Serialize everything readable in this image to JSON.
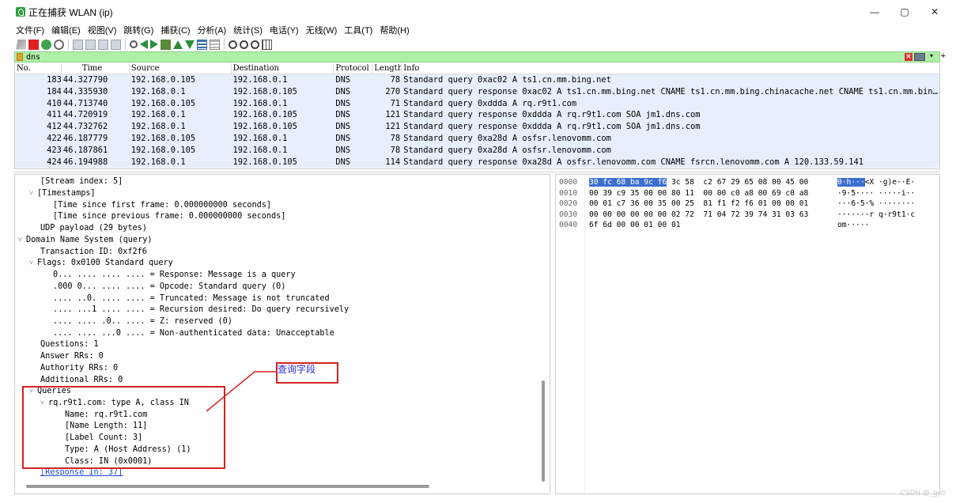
{
  "window": {
    "title": "正在捕获 WLAN (ip)",
    "controls": {
      "minimize": "—",
      "maximize": "▢",
      "close": "✕"
    }
  },
  "menu": [
    "文件(F)",
    "编辑(E)",
    "视图(V)",
    "跳转(G)",
    "捕获(C)",
    "分析(A)",
    "统计(S)",
    "电话(Y)",
    "无线(W)",
    "工具(T)",
    "帮助(H)"
  ],
  "toolbar": {
    "icons": [
      "shark-fin-icon",
      "stop-icon",
      "restart-icon",
      "capture-options-icon",
      "open-file-icon",
      "save-file-icon",
      "close-file-icon",
      "reload-icon",
      "find-icon",
      "go-back-icon",
      "go-forward-icon",
      "go-to-packet-icon",
      "first-packet-icon",
      "last-packet-icon",
      "autoscroll-icon",
      "colorize-icon",
      "zoom-in-icon",
      "zoom-out-icon",
      "zoom-normal-icon",
      "resize-columns-icon"
    ]
  },
  "filter": {
    "value": "dns"
  },
  "packet_list": {
    "columns": [
      "No.",
      "Time",
      "Source",
      "Destination",
      "Protocol",
      "Length",
      "Info"
    ],
    "rows": [
      {
        "no": "183",
        "time": "44.327790",
        "src": "192.168.0.105",
        "dst": "192.168.0.1",
        "proto": "DNS",
        "len": "78",
        "info": "Standard query 0xac02 A ts1.cn.mm.bing.net"
      },
      {
        "no": "184",
        "time": "44.335930",
        "src": "192.168.0.1",
        "dst": "192.168.0.105",
        "proto": "DNS",
        "len": "270",
        "info": "Standard query response 0xac02 A ts1.cn.mm.bing.net CNAME ts1.cn.mm.bing.chinacache.net CNAME ts1.cn.mm.bing…"
      },
      {
        "no": "410",
        "time": "44.713740",
        "src": "192.168.0.105",
        "dst": "192.168.0.1",
        "proto": "DNS",
        "len": "71",
        "info": "Standard query 0xddda A rq.r9t1.com"
      },
      {
        "no": "411",
        "time": "44.720919",
        "src": "192.168.0.1",
        "dst": "192.168.0.105",
        "proto": "DNS",
        "len": "121",
        "info": "Standard query response 0xddda A rq.r9t1.com SOA jm1.dns.com"
      },
      {
        "no": "412",
        "time": "44.732762",
        "src": "192.168.0.1",
        "dst": "192.168.0.105",
        "proto": "DNS",
        "len": "121",
        "info": "Standard query response 0xddda A rq.r9t1.com SOA jm1.dns.com"
      },
      {
        "no": "422",
        "time": "46.187779",
        "src": "192.168.0.105",
        "dst": "192.168.0.1",
        "proto": "DNS",
        "len": "78",
        "info": "Standard query 0xa28d A osfsr.lenovomm.com"
      },
      {
        "no": "423",
        "time": "46.187861",
        "src": "192.168.0.105",
        "dst": "192.168.0.1",
        "proto": "DNS",
        "len": "78",
        "info": "Standard query 0xa28d A osfsr.lenovomm.com"
      },
      {
        "no": "424",
        "time": "46.194988",
        "src": "192.168.0.1",
        "dst": "192.168.0.105",
        "proto": "DNS",
        "len": "114",
        "info": "Standard query response 0xa28d A osfsr.lenovomm.com CNAME fsrcn.lenovomm.com A 120.133.59.141"
      }
    ]
  },
  "details": {
    "stream_index": "[Stream index: 5]",
    "timestamps": "[Timestamps]",
    "time_first": "[Time since first frame: 0.000000000 seconds]",
    "time_prev": "[Time since previous frame: 0.000000000 seconds]",
    "udp_payload": "UDP payload (29 bytes)",
    "dns": "Domain Name System (query)",
    "transaction_id": "Transaction ID: 0xf2f6",
    "flags": "Flags: 0x0100 Standard query",
    "flag_response": "0... .... .... .... = Response: Message is a query",
    "flag_opcode": ".000 0... .... .... = Opcode: Standard query (0)",
    "flag_truncated": ".... ..0. .... .... = Truncated: Message is not truncated",
    "flag_recursion": ".... ...1 .... .... = Recursion desired: Do query recursively",
    "flag_z": ".... .... .0.. .... = Z: reserved (0)",
    "flag_nonauth": ".... .... ...0 .... = Non-authenticated data: Unacceptable",
    "questions": "Questions: 1",
    "answer_rrs": "Answer RRs: 0",
    "authority_rrs": "Authority RRs: 0",
    "additional_rrs": "Additional RRs: 0",
    "queries": "Queries",
    "query": "rq.r9t1.com: type A, class IN",
    "name": "Name: rq.r9t1.com",
    "name_length": "[Name Length: 11]",
    "label_count": "[Label Count: 3]",
    "type": "Type: A (Host Address) (1)",
    "class": "Class: IN (0x0001)",
    "response_in": "[Response In: 37]"
  },
  "bytes": [
    {
      "offset": "0000",
      "hex_hl": "30 fc 68 ba 9c f6",
      "hex_rest": " 3c 58  c2 67 29 65 08 00 45 00",
      "ascii_hl": "0·h···",
      "ascii_rest": "<X ·g)e··E·"
    },
    {
      "offset": "0010",
      "hex_hl": "",
      "hex_rest": "00 39 c9 35 00 00 80 11  00 00 c0 a8 00 69 c0 a8",
      "ascii_hl": "",
      "ascii_rest": "·9·5···· ·····i··"
    },
    {
      "offset": "0020",
      "hex_hl": "",
      "hex_rest": "00 01 c7 36 00 35 00 25  81 f1 f2 f6 01 00 00 01",
      "ascii_hl": "",
      "ascii_rest": "···6·5·% ········"
    },
    {
      "offset": "0030",
      "hex_hl": "",
      "hex_rest": "00 00 00 00 00 00 02 72  71 04 72 39 74 31 03 63",
      "ascii_hl": "",
      "ascii_rest": "·······r q·r9t1·c"
    },
    {
      "offset": "0040",
      "hex_hl": "",
      "hex_rest": "6f 6d 00 00 01 00 01",
      "ascii_hl": "",
      "ascii_rest": "om·····"
    }
  ],
  "annotation": {
    "label": "查询字段",
    "color": "#d42222",
    "label_color": "#2b2bd4"
  },
  "watermark": "CSDN @_gyd",
  "colors": {
    "row_bg": "#e7eefc",
    "filter_bg": "#aff0a8",
    "byte_highlight": "#3d6fd1"
  }
}
